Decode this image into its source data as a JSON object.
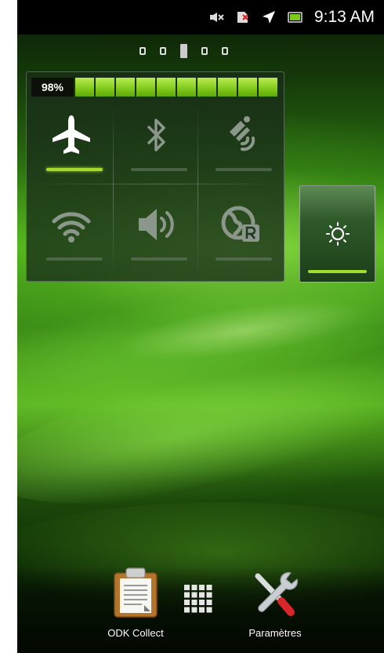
{
  "status_bar": {
    "time": "9:13 AM",
    "icons": [
      "vibrate-muted-icon",
      "no-sim-icon",
      "airplane-mode-icon",
      "battery-icon"
    ]
  },
  "home": {
    "pages": 5,
    "current_page": 3
  },
  "power_widget": {
    "battery_percent": "98%",
    "battery_level": 0.98,
    "toggles": [
      {
        "icon": "airplane-icon",
        "state": "on"
      },
      {
        "icon": "bluetooth-icon",
        "state": "off"
      },
      {
        "icon": "gps-icon",
        "state": "off"
      },
      {
        "icon": "wifi-icon",
        "state": "off"
      },
      {
        "icon": "sound-icon",
        "state": "off"
      },
      {
        "icon": "data-roaming-icon",
        "state": "off"
      }
    ]
  },
  "brightness_widget": {
    "icon": "brightness-icon",
    "state": "on"
  },
  "dock": {
    "apps": [
      {
        "label": "ODK Collect",
        "icon": "clipboard-icon"
      },
      {
        "label": "Paramètres",
        "icon": "tools-icon"
      }
    ],
    "app_drawer_icon": "app-grid-icon"
  },
  "colors": {
    "accent_green": "#a4dc2e",
    "battery_green": "#7ec81a"
  }
}
